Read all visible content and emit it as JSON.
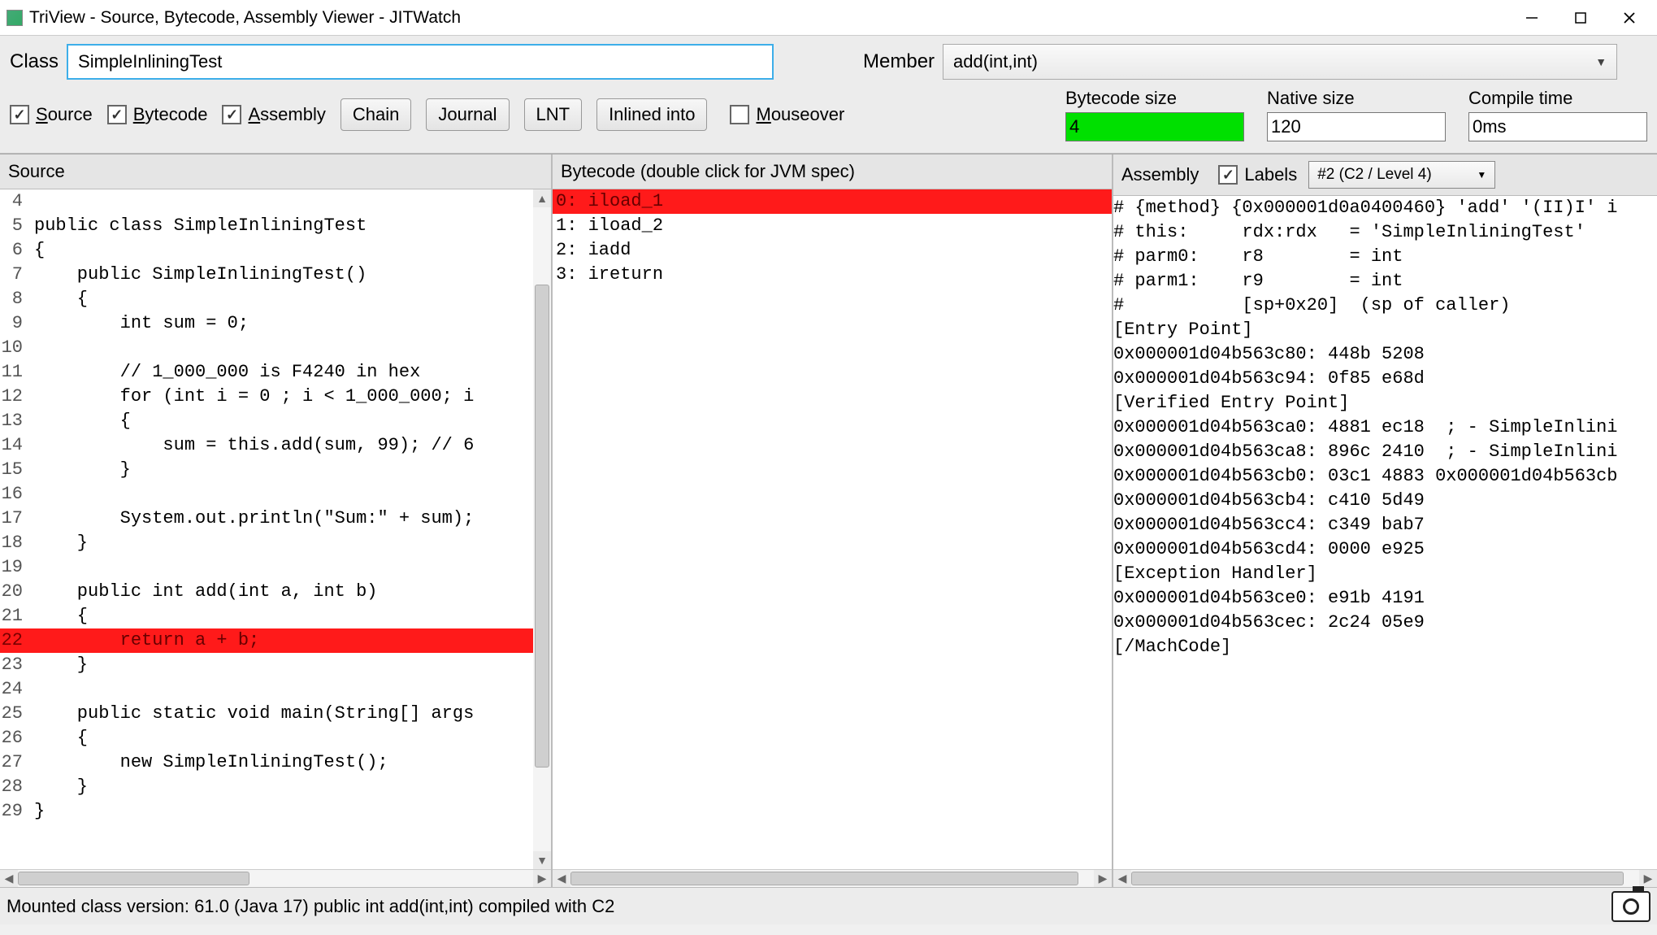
{
  "window": {
    "title": "TriView - Source, Bytecode, Assembly Viewer - JITWatch"
  },
  "topbar": {
    "class_label": "Class",
    "class_value": "SimpleInliningTest",
    "member_label": "Member",
    "member_value": "add(int,int)"
  },
  "toggles": {
    "source": "Source",
    "bytecode": "Bytecode",
    "assembly": "Assembly",
    "mouseover": "Mouseover",
    "source_checked": true,
    "bytecode_checked": true,
    "assembly_checked": true,
    "mouseover_checked": false
  },
  "buttons": {
    "chain": "Chain",
    "journal": "Journal",
    "lnt": "LNT",
    "inlined": "Inlined into"
  },
  "metrics": {
    "bc_label": "Bytecode size",
    "bc_value": "4",
    "native_label": "Native size",
    "native_value": "120",
    "compile_label": "Compile time",
    "compile_value": "0ms"
  },
  "panel_headers": {
    "source": "Source",
    "bytecode": "Bytecode (double click for JVM spec)",
    "assembly": "Assembly",
    "labels_check": "Labels",
    "labels_checked": true,
    "asm_select": "#2  (C2 / Level 4)"
  },
  "source_lines": [
    {
      "n": "4",
      "t": "",
      "hl": false
    },
    {
      "n": "5",
      "t": "public class SimpleInliningTest",
      "hl": false
    },
    {
      "n": "6",
      "t": "{",
      "hl": false
    },
    {
      "n": "7",
      "t": "    public SimpleInliningTest()",
      "hl": false
    },
    {
      "n": "8",
      "t": "    {",
      "hl": false
    },
    {
      "n": "9",
      "t": "        int sum = 0;",
      "hl": false
    },
    {
      "n": "10",
      "t": "",
      "hl": false
    },
    {
      "n": "11",
      "t": "        // 1_000_000 is F4240 in hex",
      "hl": false
    },
    {
      "n": "12",
      "t": "        for (int i = 0 ; i < 1_000_000; i",
      "hl": false
    },
    {
      "n": "13",
      "t": "        {",
      "hl": false
    },
    {
      "n": "14",
      "t": "            sum = this.add(sum, 99); // 6",
      "hl": false
    },
    {
      "n": "15",
      "t": "        }",
      "hl": false
    },
    {
      "n": "16",
      "t": "",
      "hl": false
    },
    {
      "n": "17",
      "t": "        System.out.println(\"Sum:\" + sum);",
      "hl": false
    },
    {
      "n": "18",
      "t": "    }",
      "hl": false
    },
    {
      "n": "19",
      "t": "",
      "hl": false
    },
    {
      "n": "20",
      "t": "    public int add(int a, int b)",
      "hl": false
    },
    {
      "n": "21",
      "t": "    {",
      "hl": false
    },
    {
      "n": "22",
      "t": "        return a + b;",
      "hl": true
    },
    {
      "n": "23",
      "t": "    }",
      "hl": false
    },
    {
      "n": "24",
      "t": "",
      "hl": false
    },
    {
      "n": "25",
      "t": "    public static void main(String[] args",
      "hl": false
    },
    {
      "n": "26",
      "t": "    {",
      "hl": false
    },
    {
      "n": "27",
      "t": "        new SimpleInliningTest();",
      "hl": false
    },
    {
      "n": "28",
      "t": "    }",
      "hl": false
    },
    {
      "n": "29",
      "t": "}",
      "hl": false
    }
  ],
  "bytecode_lines": [
    {
      "t": "0: iload_1",
      "hl": true
    },
    {
      "t": "1: iload_2",
      "hl": false
    },
    {
      "t": "2: iadd",
      "hl": false
    },
    {
      "t": "3: ireturn",
      "hl": false
    }
  ],
  "assembly_lines": [
    "# {method} {0x000001d0a0400460} 'add' '(II)I' i",
    "# this:     rdx:rdx   = 'SimpleInliningTest'",
    "# parm0:    r8        = int",
    "# parm1:    r9        = int",
    "#           [sp+0x20]  (sp of caller)",
    "[Entry Point]",
    "0x000001d04b563c80: 448b 5208",
    "0x000001d04b563c94: 0f85 e68d",
    "[Verified Entry Point]",
    "0x000001d04b563ca0: 4881 ec18  ; - SimpleInlini",
    "0x000001d04b563ca8: 896c 2410  ; - SimpleInlini",
    "0x000001d04b563cb0: 03c1 4883 0x000001d04b563cb",
    "0x000001d04b563cb4: c410 5d49",
    "0x000001d04b563cc4: c349 bab7",
    "0x000001d04b563cd4: 0000 e925",
    "[Exception Handler]",
    "0x000001d04b563ce0: e91b 4191",
    "0x000001d04b563cec: 2c24 05e9",
    "[/MachCode]"
  ],
  "status": "Mounted class version: 61.0 (Java 17) public int add(int,int) compiled with C2"
}
